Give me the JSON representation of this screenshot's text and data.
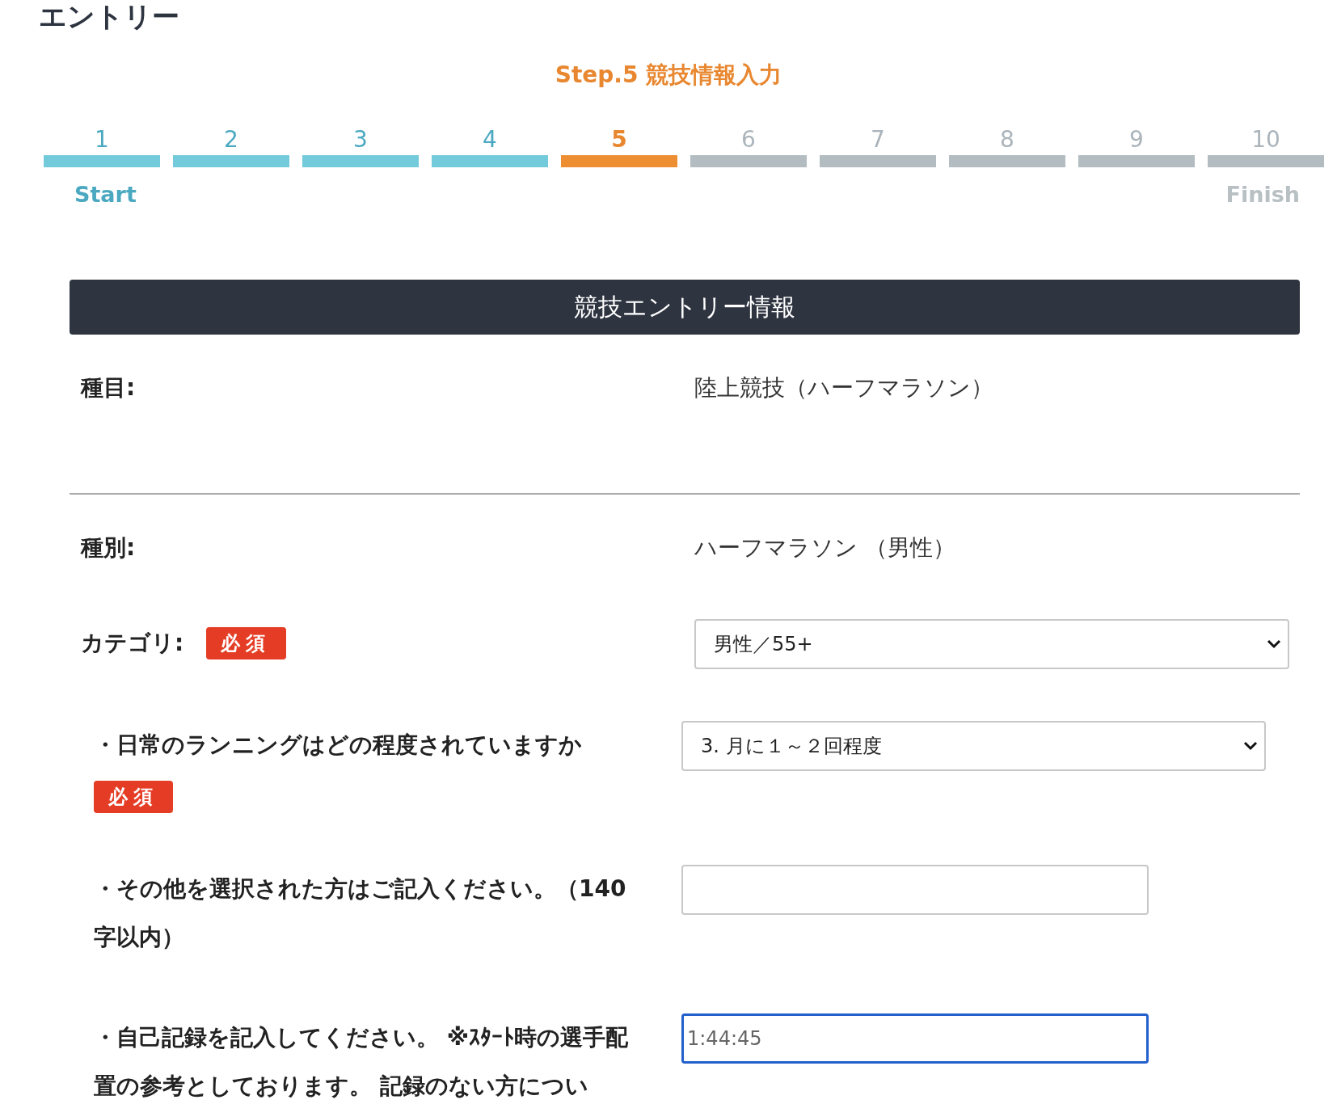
{
  "page_title": "エントリー",
  "step_heading": "Step.5 競技情報入力",
  "steps": [
    {
      "label": "1",
      "completed": true,
      "selected": false
    },
    {
      "label": "2",
      "completed": true,
      "selected": false
    },
    {
      "label": "3",
      "completed": true,
      "selected": false
    },
    {
      "label": "4",
      "completed": true,
      "selected": false
    },
    {
      "label": "5",
      "selected": true
    },
    {
      "label": "6",
      "completed": false,
      "selected": false
    },
    {
      "label": "7",
      "completed": false,
      "selected": false
    },
    {
      "label": "8",
      "completed": false,
      "selected": false
    },
    {
      "label": "9",
      "completed": false,
      "selected": false
    },
    {
      "label": "10",
      "completed": false,
      "selected": false
    }
  ],
  "start_label": "Start",
  "finish_label": "Finish",
  "section_title": "競技エントリー情報",
  "rows": [
    {
      "kind": "text",
      "label": "種目:",
      "value": "陸上競技（ハーフマラソン）",
      "divider": true
    },
    {
      "kind": "text",
      "label": "種別:",
      "value": "ハーフマラソン （男性）",
      "divider": false
    },
    {
      "kind": "select",
      "label": "カテゴリ:",
      "required": "必須",
      "value": "男性／55+",
      "sub": false
    },
    {
      "kind": "select",
      "label": "・日常のランニングはどの程度されていますか",
      "required": "必須",
      "value": "3.  月に１～２回程度",
      "sub": true
    },
    {
      "kind": "input",
      "label": "・その他を選択された方はご記入ください。（140字以内）",
      "value": "",
      "focused": false,
      "sub": true
    },
    {
      "kind": "input",
      "label": "・自己記録を記入してください。 ※ｽﾀｰﾄ時の選手配置の参考としております。 記録のない方につい",
      "value": "1:44:45",
      "focused": true,
      "sub": true
    }
  ]
}
